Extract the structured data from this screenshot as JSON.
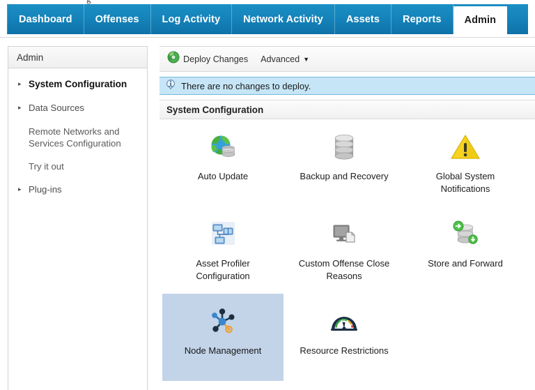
{
  "top_partial": {
    "glyph": "g"
  },
  "nav": {
    "tabs": [
      {
        "label": "Dashboard",
        "active": false
      },
      {
        "label": "Offenses",
        "active": false
      },
      {
        "label": "Log Activity",
        "active": false
      },
      {
        "label": "Network Activity",
        "active": false
      },
      {
        "label": "Assets",
        "active": false
      },
      {
        "label": "Reports",
        "active": false
      },
      {
        "label": "Admin",
        "active": true
      }
    ],
    "active_tab": "Admin",
    "bar_color": "#1584bb",
    "active_tab_bg": "#ffffff"
  },
  "sidebar": {
    "title": "Admin",
    "items": [
      {
        "label": "System Configuration",
        "arrow": "▸",
        "selected": true,
        "sub": false
      },
      {
        "label": "Data Sources",
        "arrow": "▸",
        "selected": false,
        "sub": false
      },
      {
        "label": "Remote Networks and Services Configuration",
        "arrow": "",
        "selected": false,
        "sub": true
      },
      {
        "label": "Try it out",
        "arrow": "",
        "selected": false,
        "sub": true
      },
      {
        "label": "Plug-ins",
        "arrow": "▸",
        "selected": false,
        "sub": false
      }
    ]
  },
  "toolbar": {
    "deploy_label": "Deploy Changes",
    "deploy_icon": "deploy-changes-icon",
    "advanced_label": "Advanced",
    "advanced_caret": "▼"
  },
  "info_banner": {
    "icon": "info-icon",
    "message": "There are no changes to deploy.",
    "background": "#c6e6f7",
    "border": "#76b9da"
  },
  "section": {
    "title": "System Configuration"
  },
  "tiles": [
    {
      "label": "Auto Update",
      "icon": "globe-database-icon",
      "selected": false
    },
    {
      "label": "Backup and Recovery",
      "icon": "database-stack-icon",
      "selected": false
    },
    {
      "label": "Global System Notifications",
      "icon": "warning-triangle-icon",
      "selected": false
    },
    {
      "label": "Asset Profiler Configuration",
      "icon": "network-nodes-icon",
      "selected": false
    },
    {
      "label": "Custom Offense Close Reasons",
      "icon": "monitor-document-icon",
      "selected": false
    },
    {
      "label": "Store and Forward",
      "icon": "store-forward-icon",
      "selected": false
    },
    {
      "label": "Node Management",
      "icon": "node-graph-icon",
      "selected": true
    },
    {
      "label": "Resource Restrictions",
      "icon": "gauge-icon",
      "selected": false
    }
  ],
  "colors": {
    "selected_tile": "#c3d4e9",
    "nav_blue": "#1584bb",
    "panel_border": "#d3d3d3"
  }
}
